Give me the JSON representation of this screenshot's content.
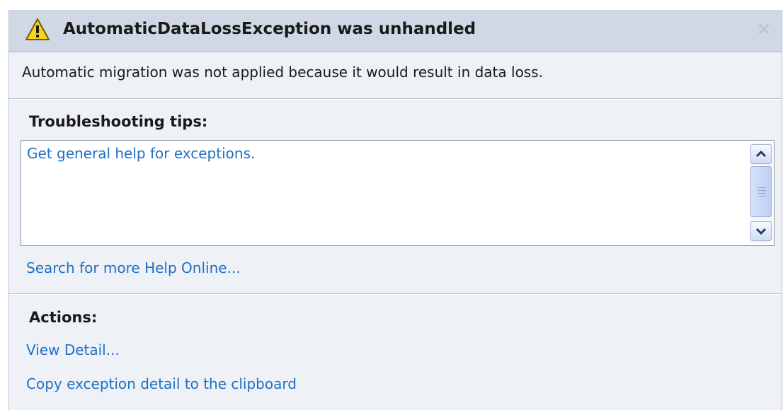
{
  "dialog": {
    "title": "AutomaticDataLossException was unhandled",
    "message": "Automatic migration was not applied because it would result in data loss.",
    "close_glyph": "×"
  },
  "troubleshooting": {
    "heading": "Troubleshooting tips:",
    "tips": [
      "Get general help for exceptions."
    ],
    "search_link": "Search for more Help Online..."
  },
  "actions": {
    "heading": "Actions:",
    "items": [
      "View Detail...",
      "Copy exception detail to the clipboard"
    ]
  },
  "icons": {
    "warning": "warning-triangle-icon",
    "close": "close-icon",
    "scroll_up": "chevron-up-icon",
    "scroll_down": "chevron-down-icon"
  },
  "colors": {
    "title_bar": "#cfd8e4",
    "body": "#eef1f6",
    "link": "#1f6fc6",
    "warning_yellow": "#f7d31a"
  }
}
